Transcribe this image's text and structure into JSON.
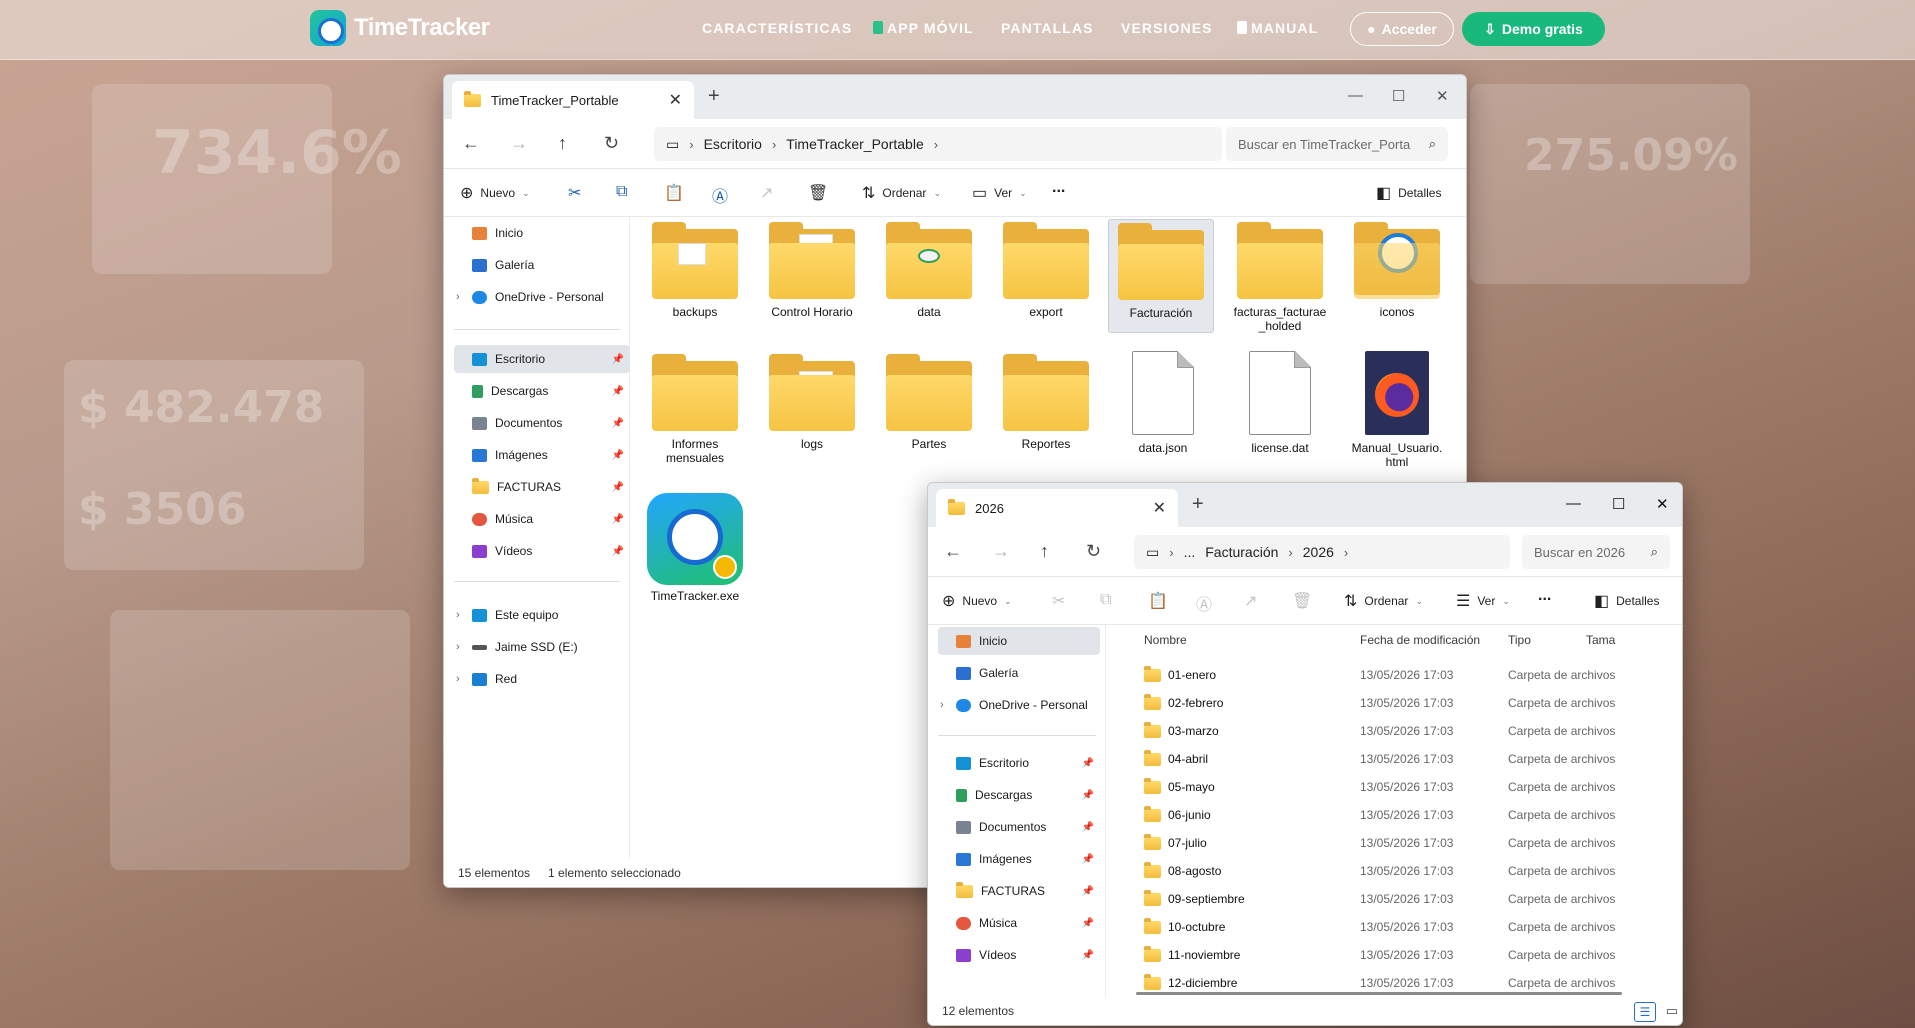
{
  "site": {
    "brand": "TimeTracker",
    "nav": [
      "CARACTERÍSTICAS",
      "APP MÓVIL",
      "PANTALLAS",
      "VERSIONES",
      "MANUAL"
    ],
    "login_label": "Acceder",
    "demo_label": "Demo gratis"
  },
  "background_figures": [
    "734.6%",
    "275.09%",
    "$ 482.478",
    "$ 3506"
  ],
  "explorer_main": {
    "tab_title": "TimeTracker_Portable",
    "breadcrumb": [
      "Escritorio",
      "TimeTracker_Portable"
    ],
    "search_placeholder": "Buscar en TimeTracker_Porta",
    "commands": {
      "new": "Nuevo",
      "sort": "Ordenar",
      "view": "Ver",
      "more": "...",
      "details": "Detalles"
    },
    "nav_items": [
      {
        "label": "Inicio",
        "icon": "home-icon"
      },
      {
        "label": "Galería",
        "icon": "gallery-icon"
      },
      {
        "label": "OneDrive - Personal",
        "icon": "cloud-icon"
      },
      {
        "label": "Escritorio",
        "icon": "desktop-icon"
      },
      {
        "label": "Descargas",
        "icon": "download-icon"
      },
      {
        "label": "Documentos",
        "icon": "document-icon"
      },
      {
        "label": "Imágenes",
        "icon": "image-icon"
      },
      {
        "label": "FACTURAS",
        "icon": "folder-icon"
      },
      {
        "label": "Música",
        "icon": "music-icon"
      },
      {
        "label": "Vídeos",
        "icon": "video-icon"
      },
      {
        "label": "Este equipo",
        "icon": "computer-icon"
      },
      {
        "label": "Jaime SSD (E:)",
        "icon": "drive-icon"
      },
      {
        "label": "Red",
        "icon": "network-icon"
      }
    ],
    "items": [
      {
        "label": "backups",
        "kind": "folder"
      },
      {
        "label": "Control Horario",
        "kind": "folder"
      },
      {
        "label": "data",
        "kind": "folder"
      },
      {
        "label": "export",
        "kind": "folder"
      },
      {
        "label": "Facturación",
        "kind": "folder",
        "selected": true
      },
      {
        "label": "facturas_facturae _holded",
        "kind": "folder"
      },
      {
        "label": "iconos",
        "kind": "folder"
      },
      {
        "label": "Informes mensuales",
        "kind": "folder"
      },
      {
        "label": "logs",
        "kind": "folder"
      },
      {
        "label": "Partes",
        "kind": "folder"
      },
      {
        "label": "Reportes",
        "kind": "folder"
      },
      {
        "label": "data.json",
        "kind": "file"
      },
      {
        "label": "license.dat",
        "kind": "file"
      },
      {
        "label": "Manual_Usuario. html",
        "kind": "html"
      },
      {
        "label": "TimeTracker.exe",
        "kind": "exe"
      }
    ],
    "status_count": "15 elementos",
    "status_selection": "1 elemento seleccionado"
  },
  "explorer_second": {
    "tab_title": "2026",
    "breadcrumb": [
      "...",
      "Facturación",
      "2026"
    ],
    "search_placeholder": "Buscar en 2026",
    "commands": {
      "new": "Nuevo",
      "sort": "Ordenar",
      "view": "Ver",
      "more": "...",
      "details": "Detalles"
    },
    "nav_items": [
      {
        "label": "Inicio"
      },
      {
        "label": "Galería"
      },
      {
        "label": "OneDrive - Personal"
      },
      {
        "label": "Escritorio"
      },
      {
        "label": "Descargas"
      },
      {
        "label": "Documentos"
      },
      {
        "label": "Imágenes"
      },
      {
        "label": "FACTURAS"
      },
      {
        "label": "Música"
      },
      {
        "label": "Vídeos"
      }
    ],
    "columns": [
      "Nombre",
      "Fecha de modificación",
      "Tipo",
      "Tama"
    ],
    "rows": [
      {
        "name": "01-enero",
        "date": "13/05/2026 17:03",
        "type": "Carpeta de archivos"
      },
      {
        "name": "02-febrero",
        "date": "13/05/2026 17:03",
        "type": "Carpeta de archivos"
      },
      {
        "name": "03-marzo",
        "date": "13/05/2026 17:03",
        "type": "Carpeta de archivos"
      },
      {
        "name": "04-abril",
        "date": "13/05/2026 17:03",
        "type": "Carpeta de archivos"
      },
      {
        "name": "05-mayo",
        "date": "13/05/2026 17:03",
        "type": "Carpeta de archivos"
      },
      {
        "name": "06-junio",
        "date": "13/05/2026 17:03",
        "type": "Carpeta de archivos"
      },
      {
        "name": "07-julio",
        "date": "13/05/2026 17:03",
        "type": "Carpeta de archivos"
      },
      {
        "name": "08-agosto",
        "date": "13/05/2026 17:03",
        "type": "Carpeta de archivos"
      },
      {
        "name": "09-septiembre",
        "date": "13/05/2026 17:03",
        "type": "Carpeta de archivos"
      },
      {
        "name": "10-octubre",
        "date": "13/05/2026 17:03",
        "type": "Carpeta de archivos"
      },
      {
        "name": "11-noviembre",
        "date": "13/05/2026 17:03",
        "type": "Carpeta de archivos"
      },
      {
        "name": "12-diciembre",
        "date": "13/05/2026 17:03",
        "type": "Carpeta de archivos"
      }
    ],
    "status_count": "12 elementos"
  },
  "colors": {
    "accent_green": "#19b97e",
    "folder_yellow": "#f6c443",
    "selection": "#e1e5ea"
  }
}
